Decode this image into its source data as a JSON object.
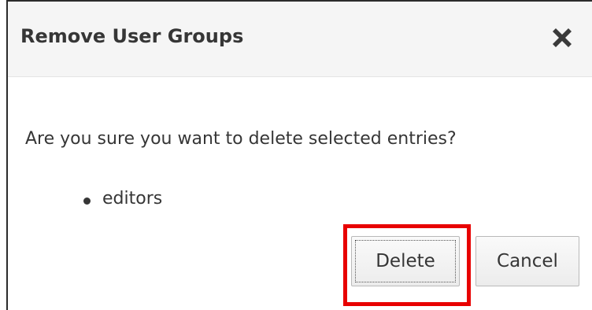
{
  "dialog": {
    "title": "Remove User Groups",
    "close_icon": "close-x-icon",
    "message": "Are you sure you want to delete selected entries?",
    "entries": [
      "editors"
    ],
    "buttons": {
      "delete_label": "Delete",
      "cancel_label": "Cancel"
    },
    "highlight_color": "#e80000"
  }
}
